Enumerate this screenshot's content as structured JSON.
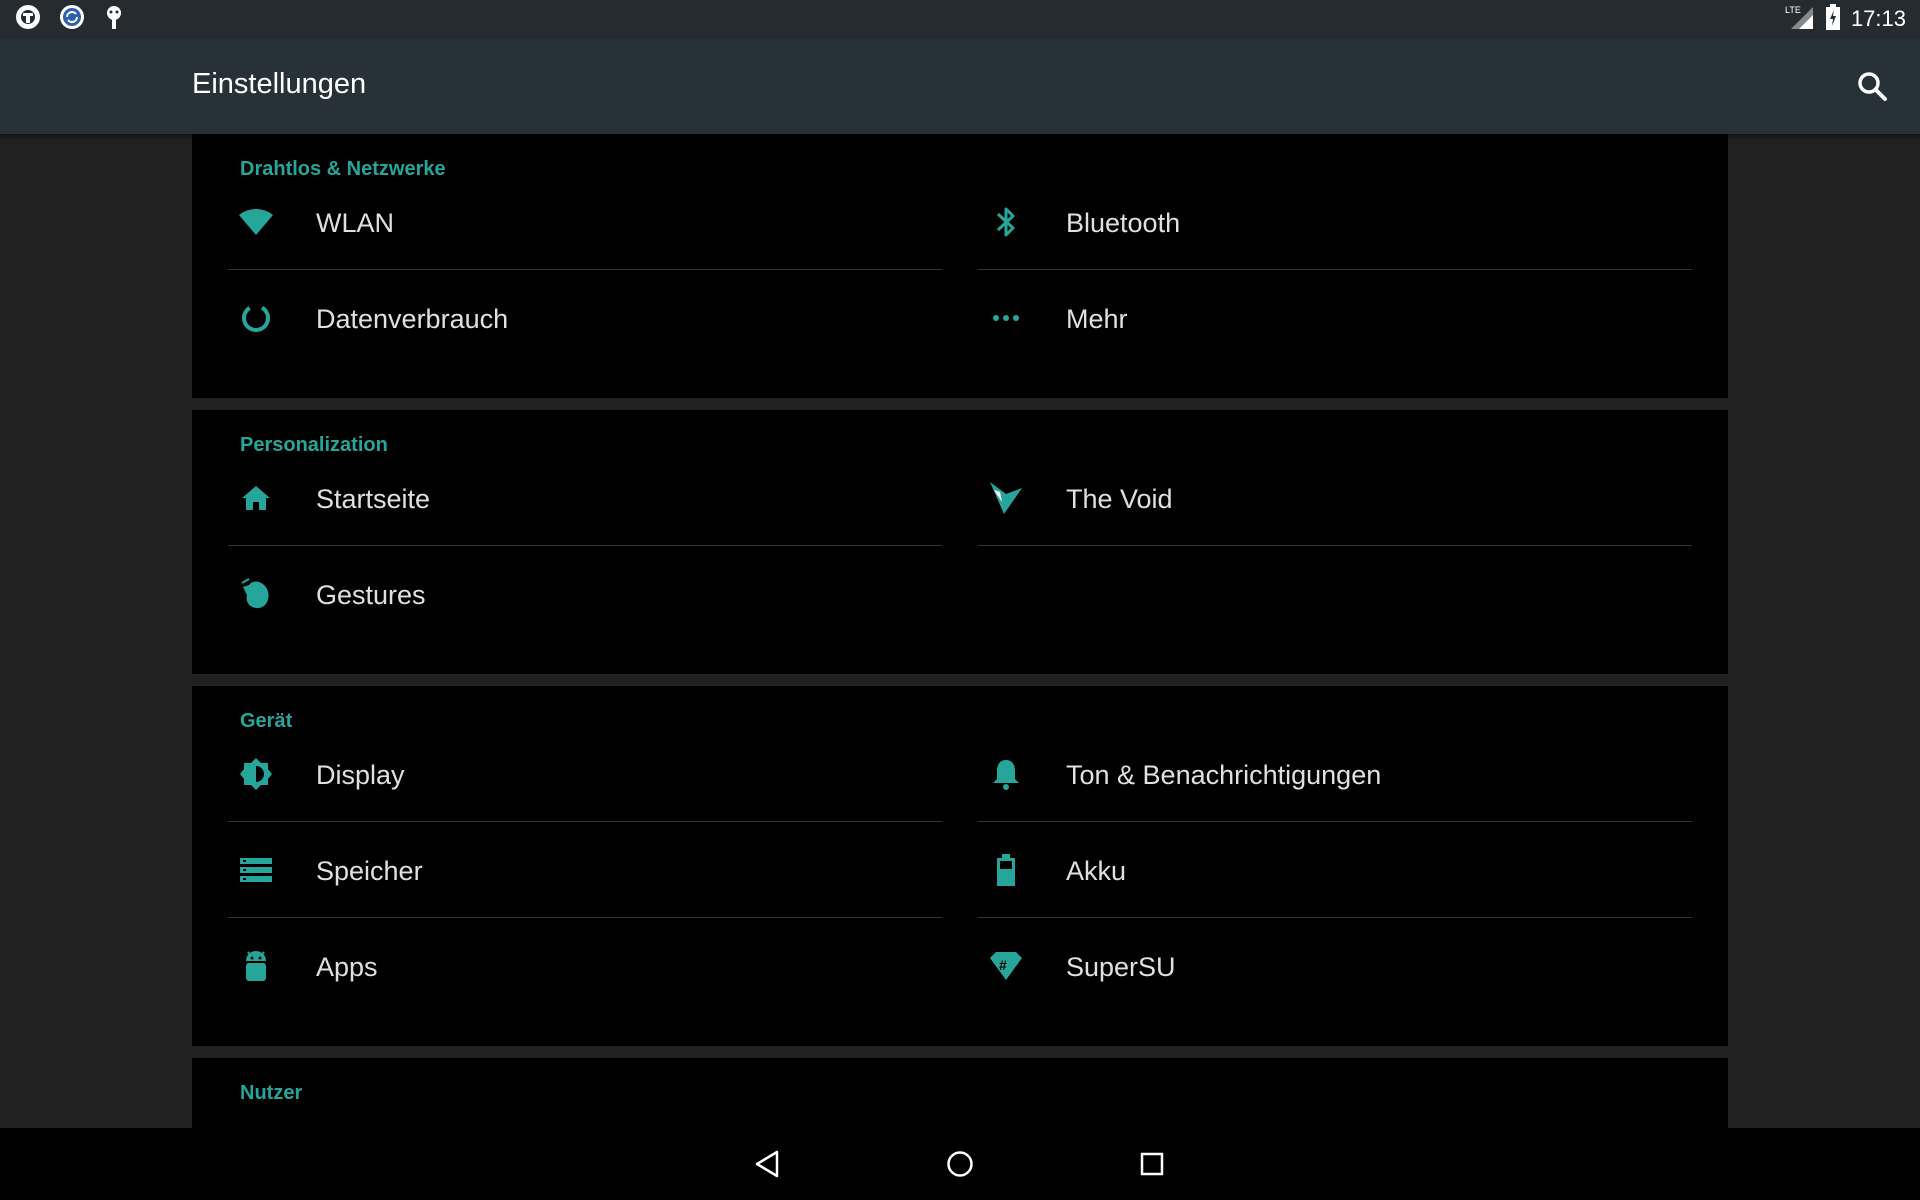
{
  "status_bar": {
    "time": "17:13",
    "network_label": "LTE",
    "left_icons": [
      "notification-app-icon",
      "sync-app-icon",
      "android-debug-icon"
    ]
  },
  "app_bar": {
    "title": "Einstellungen"
  },
  "accent_color": "#26a69a",
  "sections": [
    {
      "title": "Drahtlos & Netzwerke",
      "items": [
        {
          "label": "WLAN",
          "icon": "wifi-icon"
        },
        {
          "label": "Bluetooth",
          "icon": "bluetooth-icon"
        },
        {
          "label": "Datenverbrauch",
          "icon": "data-usage-icon"
        },
        {
          "label": "Mehr",
          "icon": "more-icon"
        }
      ]
    },
    {
      "title": "Personalization",
      "items": [
        {
          "label": "Startseite",
          "icon": "home-icon"
        },
        {
          "label": "The Void",
          "icon": "the-void-icon"
        },
        {
          "label": "Gestures",
          "icon": "gestures-icon"
        }
      ]
    },
    {
      "title": "Gerät",
      "items": [
        {
          "label": "Display",
          "icon": "brightness-icon"
        },
        {
          "label": "Ton & Benachrichtigungen",
          "icon": "bell-icon"
        },
        {
          "label": "Speicher",
          "icon": "storage-icon"
        },
        {
          "label": "Akku",
          "icon": "battery-icon"
        },
        {
          "label": "Apps",
          "icon": "android-icon"
        },
        {
          "label": "SuperSU",
          "icon": "supersu-icon"
        }
      ]
    },
    {
      "title": "Nutzer",
      "items": []
    }
  ],
  "nav_bar": {
    "buttons": [
      "back-icon",
      "home-nav-icon",
      "recents-icon"
    ]
  }
}
